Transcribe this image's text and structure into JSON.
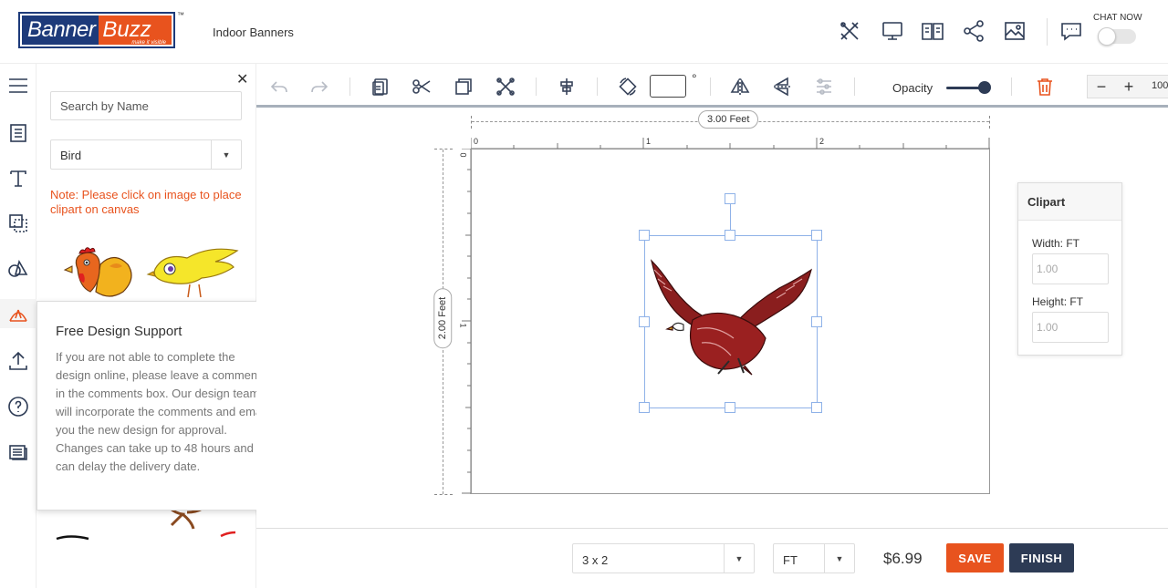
{
  "header": {
    "logo_banner": "Banner",
    "logo_buzz": "Buzz",
    "logo_tagline": "make it visible",
    "logo_tm": "™",
    "title": "Indoor Banners",
    "chat_label": "CHAT NOW",
    "icons": [
      "tools-icon",
      "monitor-icon",
      "book-icon",
      "share-icon",
      "image-icon",
      "chat-icon"
    ]
  },
  "sidebar": {
    "items": [
      {
        "name": "menu",
        "icon": "hamburger-icon"
      },
      {
        "name": "templates",
        "icon": "document-icon"
      },
      {
        "name": "text",
        "icon": "text-icon"
      },
      {
        "name": "backgrounds",
        "icon": "layers-icon"
      },
      {
        "name": "shapes",
        "icon": "shapes-icon"
      },
      {
        "name": "clipart",
        "icon": "clipart-icon",
        "active": true
      },
      {
        "name": "upload",
        "icon": "upload-icon"
      },
      {
        "name": "help",
        "icon": "help-icon"
      },
      {
        "name": "comments",
        "icon": "comments-icon"
      }
    ]
  },
  "panel": {
    "search_placeholder": "Search by Name",
    "category": "Bird",
    "note": "Note: Please click on image to place clipart on canvas"
  },
  "popup": {
    "title": "Free Design Support",
    "body": "If you are not able to complete the design online, please leave a comments in the comments box. Our design team will incorporate the comments and email you the new design for approval. Changes can take up to 48 hours and can delay the delivery date."
  },
  "toolbar": {
    "degree_symbol": "°",
    "opacity_label": "Opacity",
    "opacity_value": 1.0,
    "zoom_value": "100"
  },
  "canvas": {
    "width_label": "3.00 Feet",
    "height_label": "2.00 Feet",
    "top_ticks": [
      "0",
      "1",
      "2"
    ],
    "left_ticks": [
      "0",
      "1"
    ]
  },
  "clipart_panel": {
    "title": "Clipart",
    "width_label": "Width: FT",
    "width_placeholder": "1.00",
    "height_label": "Height: FT",
    "height_placeholder": "1.00"
  },
  "bottom": {
    "size": "3 x 2",
    "unit": "FT",
    "price": "$6.99",
    "save_label": "SAVE",
    "finish_label": "FINISH"
  },
  "colors": {
    "accent": "#e8531e",
    "navy": "#2d3b55",
    "selection": "#8fb2e8"
  }
}
